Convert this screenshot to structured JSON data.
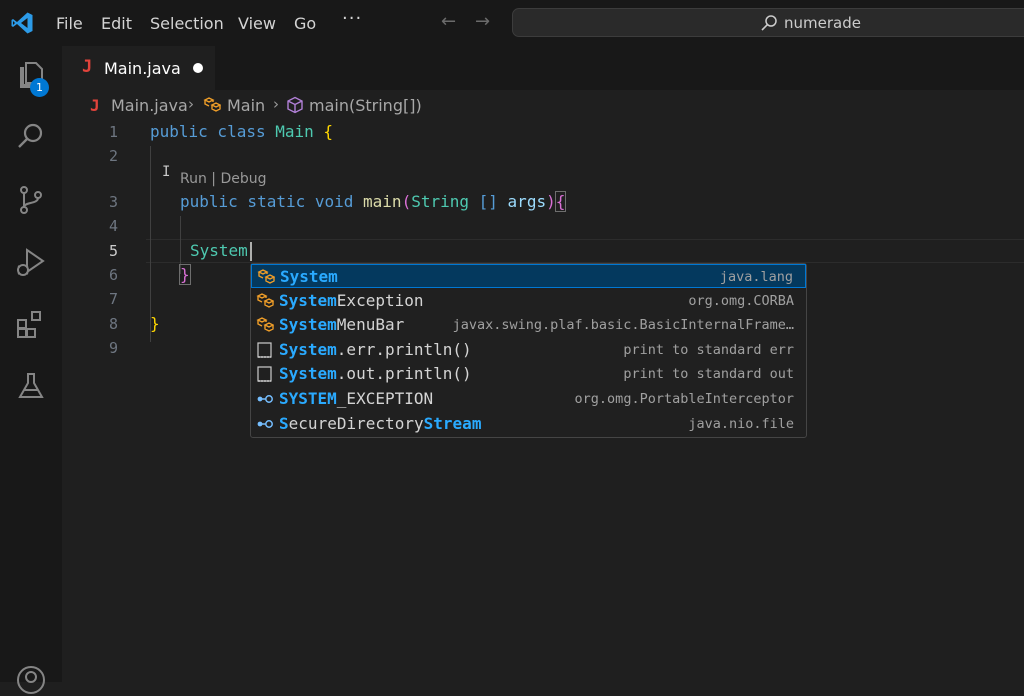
{
  "menu": {
    "file": "File",
    "edit": "Edit",
    "selection": "Selection",
    "view": "View",
    "go": "Go",
    "more": "···"
  },
  "command_center": {
    "label": "numerade"
  },
  "activity_bar": {
    "explorer_badge": "1"
  },
  "tab": {
    "label": "Main.java",
    "file_icon": "J"
  },
  "breadcrumb": {
    "file_icon": "J",
    "file": "Main.java",
    "class": "Main",
    "method": "main(String[])"
  },
  "editor": {
    "line_numbers": [
      "1",
      "2",
      "3",
      "4",
      "5",
      "6",
      "7",
      "8",
      "9"
    ],
    "active_line": "5",
    "codelens": "Run | Debug",
    "lines": {
      "l1_kw": "public class",
      "l1_name": "Main",
      "l1_brace": "{",
      "l3_kw": "public static void",
      "l3_fn": "main",
      "l3_paren_open": "(",
      "l3_type": "String",
      "l3_arr": "[]",
      "l3_param": "args",
      "l3_paren_close": ")",
      "l3_brace": "{",
      "l5_text": "System",
      "l6_brace": "}",
      "l8_brace": "}"
    }
  },
  "suggestions": [
    {
      "match": "System",
      "rest": "",
      "detail": "java.lang",
      "kind": "class",
      "selected": true
    },
    {
      "match": "System",
      "rest": "Exception",
      "detail": "org.omg.CORBA",
      "kind": "class"
    },
    {
      "match": "System",
      "rest": "MenuBar",
      "detail": "javax.swing.plaf.basic.BasicInternalFrame…",
      "kind": "class"
    },
    {
      "match": "System",
      "rest": ".err.println()",
      "detail": "print to standard err",
      "kind": "snippet"
    },
    {
      "match": "System",
      "rest": ".out.println()",
      "detail": "print to standard out",
      "kind": "snippet"
    },
    {
      "match": "SYSTEM",
      "rest": "_EXCEPTION",
      "detail": "org.omg.PortableInterceptor",
      "kind": "field"
    },
    {
      "match": "",
      "rest": "SecureDirectoryStream",
      "detail": "java.nio.file",
      "kind": "field"
    }
  ],
  "colors": {
    "accent": "#0078d4",
    "java_icon": "#e2433b",
    "match_highlight": "#2aaaff",
    "class_icon": "#ee9d28"
  }
}
